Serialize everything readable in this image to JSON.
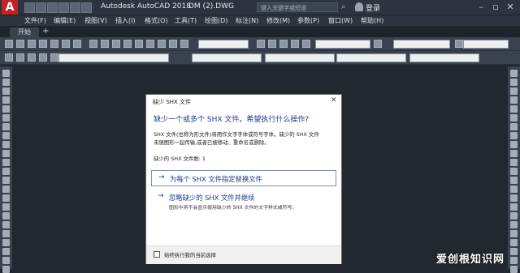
{
  "titlebar": {
    "app_title": "Autodesk AutoCAD 2018",
    "doc_title": "DM (2).DWG",
    "search_placeholder": "键入关键字或短语",
    "login": "登录"
  },
  "menu": [
    "文件(F)",
    "编辑(E)",
    "视图(V)",
    "插入(I)",
    "格式(O)",
    "工具(T)",
    "绘图(D)",
    "标注(N)",
    "修改(M)",
    "参数(P)",
    "窗口(W)",
    "帮助(H)"
  ],
  "tabs": {
    "start": "开始"
  },
  "dialog": {
    "title": "缺少 SHX 文件",
    "close": "✕",
    "heading": "缺少一个或多个 SHX 文件。希望执行什么操作?",
    "desc_line1": "SHX 文件(也称为形文件)将用作文字字体或符号字体。缺少的 SHX 文件",
    "desc_line2": "未随图形一起传输,或者已被移动、重命名或删除。",
    "count_text": "缺少的 SHX 文件数: 1",
    "option1": "为每个 SHX 文件指定替换文件",
    "option2": "忽略缺少的 SHX 文件并继续",
    "option2_sub": "图形中将不会显示使用缺少的 SHX 文件的文字样式或符号。",
    "checkbox_label": "始终执行我的当前选择",
    "checked": false
  },
  "watermark": "爱创根知识网",
  "colors": {
    "brand": "#c42126",
    "background": "#212830",
    "panel": "#39424e",
    "link": "#1a3a8a"
  },
  "icons": [
    "autocad-logo-icon",
    "search-icon",
    "user-icon",
    "minimize-icon",
    "maximize-icon",
    "close-icon",
    "arrow-right-icon"
  ]
}
